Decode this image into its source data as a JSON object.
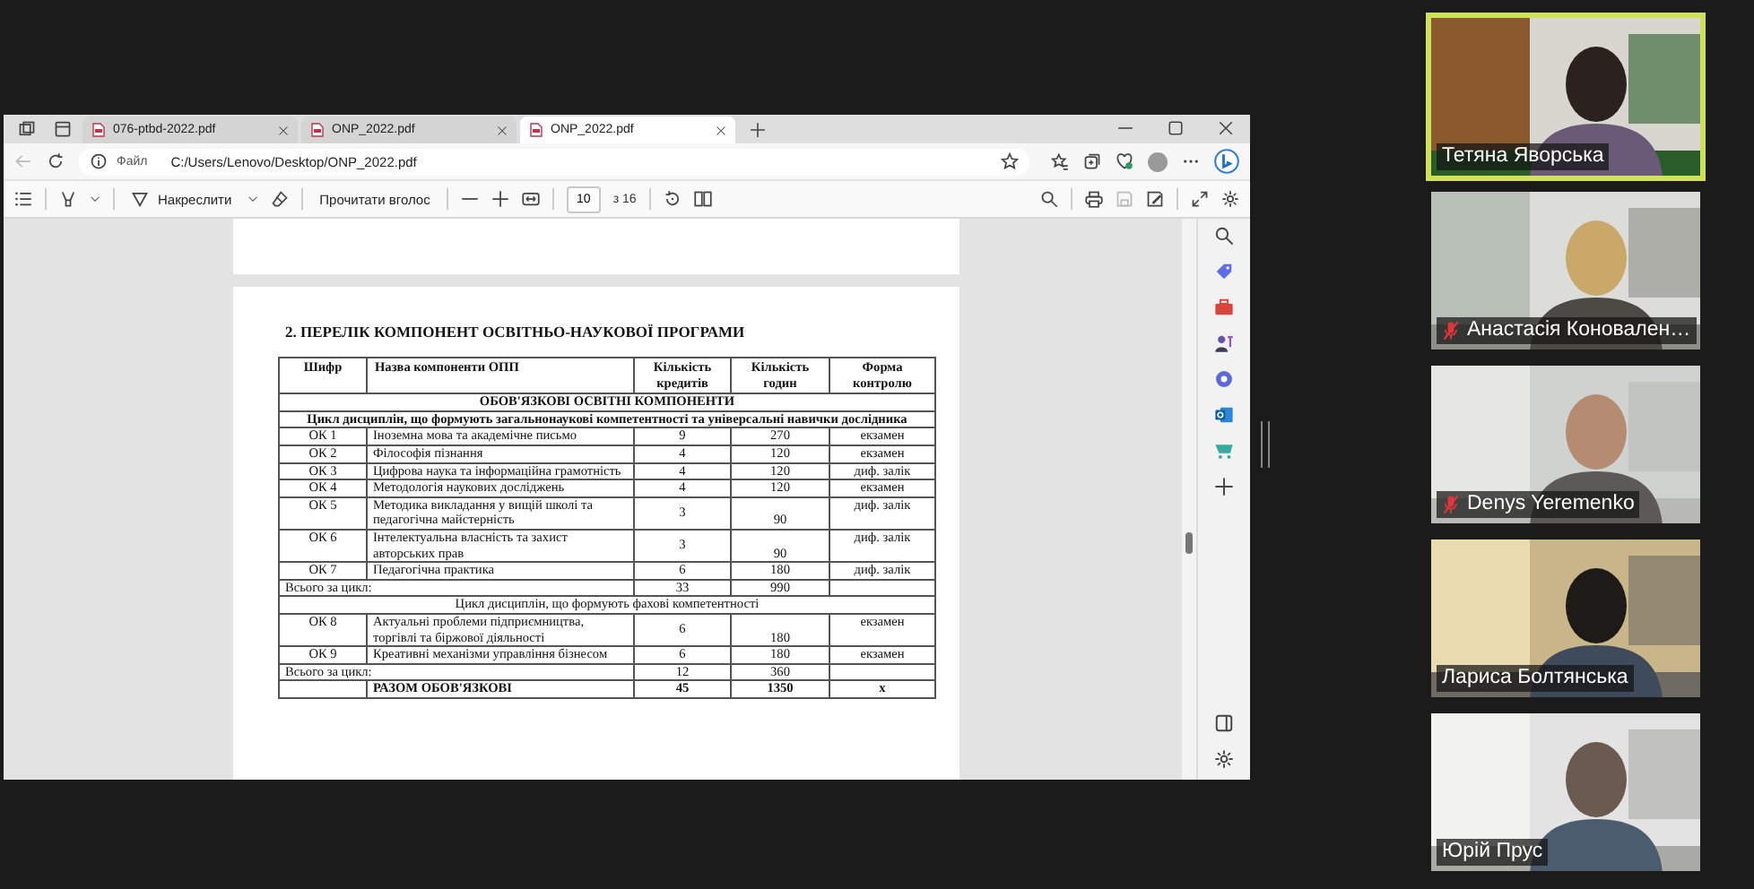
{
  "browser": {
    "tabs": [
      {
        "title": "076-ptbd-2022.pdf",
        "selected": false
      },
      {
        "title": "ONP_2022.pdf",
        "selected": false
      },
      {
        "title": "ONP_2022.pdf",
        "selected": true
      }
    ],
    "address": {
      "scheme_label": "Файл",
      "url": "C:/Users/Lenovo/Desktop/ONP_2022.pdf"
    },
    "pdf_toolbar": {
      "draw_label": "Накреслити",
      "read_aloud_label": "Прочитати вголос",
      "page": "10",
      "page_count": "з 16"
    }
  },
  "document": {
    "heading": "2. ПЕРЕЛІК КОМПОНЕНТ ОСВІТНЬО-НАУКОВОЇ ПРОГРАМИ",
    "columns": [
      "Шифр",
      "Назва компоненти ОПП",
      "Кількість кредитів",
      "Кількість годин",
      "Форма контролю"
    ],
    "rows": [
      {
        "kind": "group_heading",
        "text": "ОБОВ'ЯЗКОВІ ОСВІТНІ КОМПОНЕНТИ"
      },
      {
        "kind": "group_heading",
        "text": "Цикл дисциплін, що формують загальнонаукові компетентності та універсальні навички дослідника"
      },
      {
        "kind": "item",
        "cells": [
          "ОК 1",
          "Іноземна мова та академічне письмо",
          "9",
          "270",
          "екзамен"
        ]
      },
      {
        "kind": "item",
        "cells": [
          "ОК 2",
          "Філософія пізнання",
          "4",
          "120",
          "екзамен"
        ]
      },
      {
        "kind": "item",
        "cells": [
          "ОК 3",
          "Цифрова наука та інформаційна грамотність",
          "4",
          "120",
          "диф. залік"
        ]
      },
      {
        "kind": "item",
        "cells": [
          "ОК 4",
          "Методологія наукових досліджень",
          "4",
          "120",
          "екзамен"
        ]
      },
      {
        "kind": "item",
        "cells": [
          "ОК 5",
          "Методика викладання у вищій школі та педагогічна майстерність",
          "3",
          "90",
          "диф. залік"
        ]
      },
      {
        "kind": "item",
        "cells": [
          "ОК 6",
          "Інтелектуальна власність та захист авторських прав",
          "3",
          "90",
          "диф. залік"
        ]
      },
      {
        "kind": "item",
        "cells": [
          "ОК 7",
          "Педагогічна практика",
          "6",
          "180",
          "диф. залік"
        ]
      },
      {
        "kind": "total",
        "cells": [
          "Всього за цикл:",
          "33",
          "990"
        ]
      },
      {
        "kind": "group",
        "text": "Цикл дисциплін, що формують фахові компетентності"
      },
      {
        "kind": "item",
        "cells": [
          "ОК 8",
          "Актуальні проблеми підприємництва, торгівлі та біржової діяльності",
          "6",
          "180",
          "екзамен"
        ]
      },
      {
        "kind": "item",
        "cells": [
          "ОК 9",
          "Креативні механізми управління бізнесом",
          "6",
          "180",
          "екзамен"
        ]
      },
      {
        "kind": "total",
        "cells": [
          "Всього за цикл:",
          "12",
          "360"
        ]
      },
      {
        "kind": "grand_total",
        "cells": [
          "РАЗОМ ОБОВ'ЯЗКОВІ",
          "45",
          "1350",
          "х"
        ]
      }
    ]
  },
  "participants": [
    {
      "name": "Тетяна Яворська",
      "speaking": true,
      "muted": false
    },
    {
      "name": "Анастасія Коновален…",
      "speaking": false,
      "muted": true
    },
    {
      "name": "Denys Yeremenko",
      "speaking": false,
      "muted": true
    },
    {
      "name": "Лариса Болтянська",
      "speaking": false,
      "muted": false
    },
    {
      "name": "Юрій Прус",
      "speaking": false,
      "muted": false
    }
  ]
}
